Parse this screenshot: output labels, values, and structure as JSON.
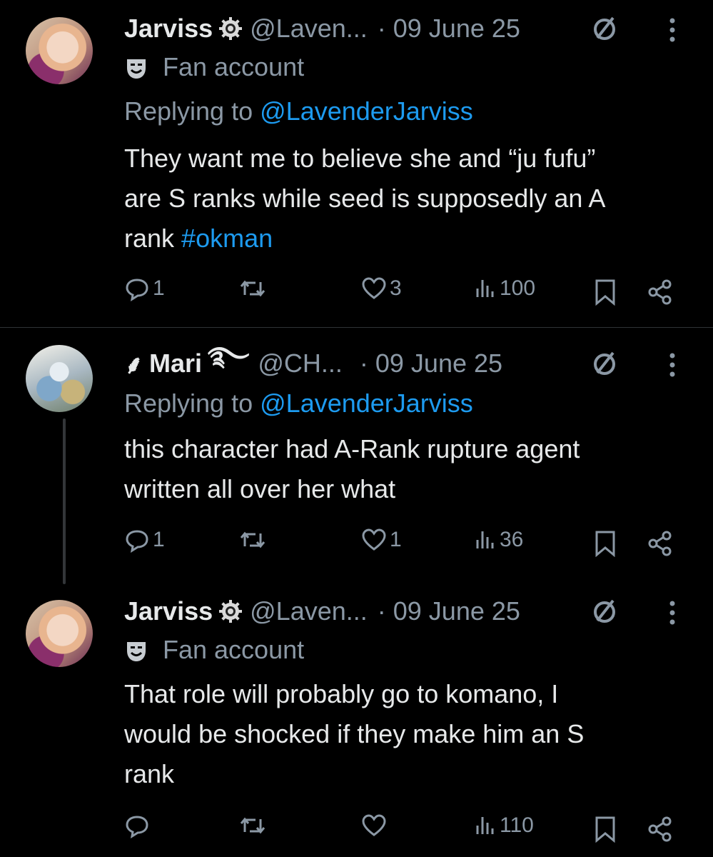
{
  "tweets": [
    {
      "name": "Jarviss",
      "handle": "@Laven...",
      "date": "· 09 June 25",
      "badge": "Fan account",
      "reply_label": "Replying to",
      "reply_to": "@LavenderJarviss",
      "text_lines": [
        "They want me to believe she and “ju fufu”",
        "are S ranks while seed is supposedly an A"
      ],
      "text_last": "rank",
      "hashtag": "#okman",
      "replies": "1",
      "retweets": "",
      "likes": "3",
      "views": "100"
    },
    {
      "name": "Mari",
      "name_deco_left": "⸙",
      "name_deco_right": "࿐",
      "handle": "@CH...",
      "date": "· 09 June 25",
      "reply_label": "Replying to",
      "reply_to": "@LavenderJarviss",
      "text_lines": [
        "this character had A-Rank rupture agent",
        "written all over her what"
      ],
      "replies": "1",
      "retweets": "",
      "likes": "1",
      "views": "36"
    },
    {
      "name": "Jarviss",
      "handle": "@Laven...",
      "date": "· 09 June 25",
      "badge": "Fan account",
      "text_lines": [
        "That role will probably go to komano, I",
        "would be shocked if they make him an S",
        "rank"
      ],
      "replies": "",
      "retweets": "",
      "likes": "",
      "views": "110"
    }
  ],
  "colors": {
    "background": "#000000",
    "text": "#e7e9ea",
    "muted": "#8b98a5",
    "link": "#1d9bf0",
    "divider": "#2f3336"
  },
  "icons": [
    "reply-icon",
    "retweet-icon",
    "like-icon",
    "views-icon",
    "bookmark-icon",
    "share-icon",
    "no-icon",
    "more-icon",
    "verified-gear-icon",
    "theater-mask-icon"
  ]
}
